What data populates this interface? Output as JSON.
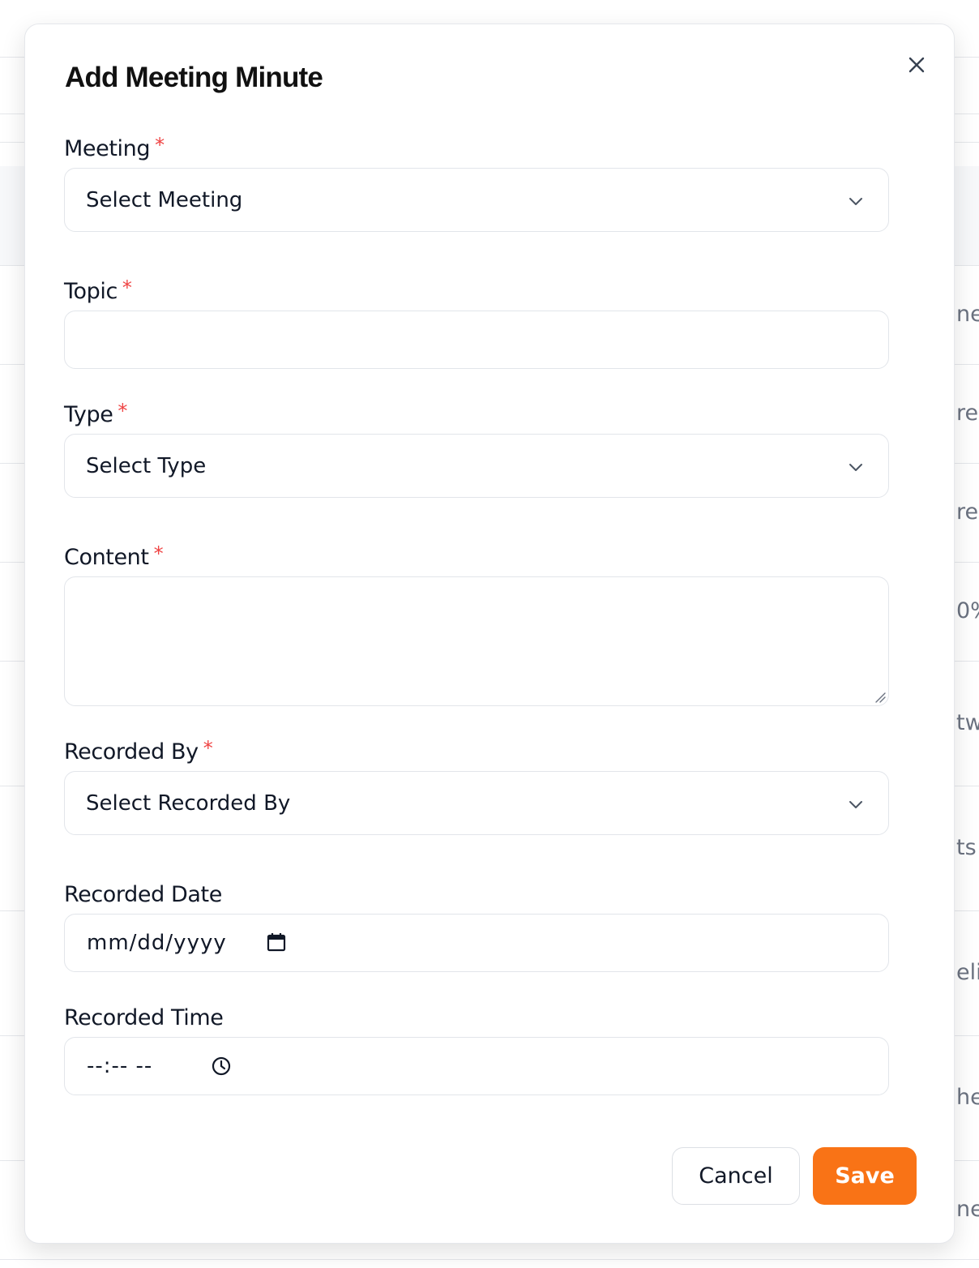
{
  "modal": {
    "title": "Add Meeting Minute",
    "close_icon": "close-icon"
  },
  "fields": {
    "meeting": {
      "label": "Meeting",
      "required_mark": "*",
      "selected": "Select Meeting"
    },
    "topic": {
      "label": "Topic",
      "required_mark": "*",
      "value": ""
    },
    "type": {
      "label": "Type",
      "required_mark": "*",
      "selected": "Select Type"
    },
    "content": {
      "label": "Content",
      "required_mark": "*",
      "value": ""
    },
    "recorded_by": {
      "label": "Recorded By",
      "required_mark": "*",
      "selected": "Select Recorded By"
    },
    "recorded_date": {
      "label": "Recorded Date",
      "placeholder": "mm/dd/yyyy",
      "icon": "calendar-icon"
    },
    "recorded_time": {
      "label": "Recorded Time",
      "placeholder": "--:-- --",
      "icon": "clock-icon"
    }
  },
  "actions": {
    "cancel_label": "Cancel",
    "save_label": "Save"
  },
  "background": {
    "row_fragments": [
      "ne",
      "re",
      "re",
      "0%",
      "tw",
      "ts (",
      "elir",
      "he",
      "ne"
    ]
  },
  "colors": {
    "accent": "#f97316",
    "required": "#ef4444",
    "border": "#e2e5ea"
  }
}
